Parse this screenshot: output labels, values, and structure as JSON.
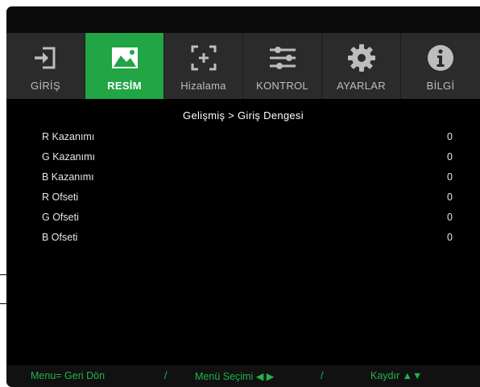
{
  "tabs": [
    {
      "label": "GİRİŞ",
      "icon": "input-icon",
      "active": false
    },
    {
      "label": "RESİM",
      "icon": "image-icon",
      "active": true
    },
    {
      "label": "Hizalama",
      "icon": "alignment-icon",
      "active": false
    },
    {
      "label": "KONTROL",
      "icon": "sliders-icon",
      "active": false
    },
    {
      "label": "AYARLAR",
      "icon": "gear-icon",
      "active": false
    },
    {
      "label": "BİLGİ",
      "icon": "info-icon",
      "active": false
    }
  ],
  "breadcrumb": "Gelişmiş > Giriş Dengesi",
  "settings": [
    {
      "name": "R Kazanımı",
      "value": "0"
    },
    {
      "name": "G Kazanımı",
      "value": "0"
    },
    {
      "name": "B Kazanımı",
      "value": "0"
    },
    {
      "name": "R Ofseti",
      "value": "0"
    },
    {
      "name": "G Ofseti",
      "value": "0"
    },
    {
      "name": "B Ofseti",
      "value": "0"
    }
  ],
  "footer": {
    "back_hint": "Menu= Geri Dön",
    "separator": "/",
    "select_hint": "Menü Seçimi ◀ ▶",
    "scroll_hint": "Kaydır ▲▼"
  },
  "colors": {
    "accent": "#21a545",
    "tab_background": "#2b2b2b",
    "osd_background": "#000000",
    "hint_text": "#21b24a"
  }
}
